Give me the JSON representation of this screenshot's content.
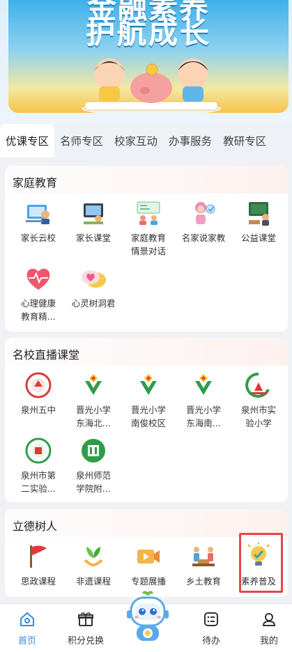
{
  "banner": {
    "title_line1": "金融素养",
    "title_line2": "护航成长"
  },
  "tabs": [
    {
      "label": "优课专区",
      "active": true
    },
    {
      "label": "名师专区"
    },
    {
      "label": "校家互动"
    },
    {
      "label": "办事服务"
    },
    {
      "label": "教研专区"
    }
  ],
  "sections": {
    "family": {
      "title": "家庭教育",
      "items": [
        "家长云校",
        "家长课堂",
        "家庭教育\n情景对话",
        "名家说家教",
        "公益课堂",
        "心理健康\n教育精...",
        "心灵树洞君"
      ]
    },
    "live": {
      "title": "名校直播课堂",
      "items": [
        "泉州五中",
        "晋光小学\n东海北...",
        "晋光小学\n南俊校区",
        "晋光小学\n东海南...",
        "泉州市实\n验小学",
        "泉州市第\n二实验...",
        "泉州师范\n学院附..."
      ]
    },
    "moral": {
      "title": "立德树人",
      "items": [
        "思政课程",
        "非遗课程",
        "专题展播",
        "乡土教育",
        "素养普及"
      ]
    }
  },
  "bottom_nav": {
    "home": "首页",
    "points": "积分兑换",
    "todo": "待办",
    "mine": "我的"
  },
  "colors": {
    "accent": "#2f8de0",
    "highlight": "#e2474a"
  }
}
